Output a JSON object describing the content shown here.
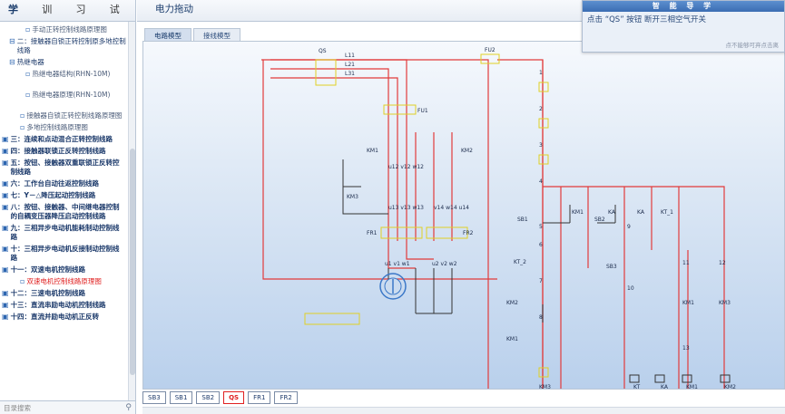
{
  "left_tabs": [
    "教学",
    "实训",
    "练习",
    "考试"
  ],
  "tree": [
    {
      "level": 3,
      "icon": "doc-icon",
      "label": "手动正转控制线路原理图"
    },
    {
      "level": 1,
      "icon": "minus-icon",
      "label": "二：接触器自锁正转控制原多地控制线路"
    },
    {
      "level": 1,
      "icon": "minus-icon",
      "label": "热继电器"
    },
    {
      "level": 3,
      "icon": "doc-icon",
      "label": "热继电器结构(RHN-10M)"
    },
    {
      "level": 3,
      "icon": "doc-icon",
      "label": "热继电器原理(RHN-10M)"
    },
    {
      "level": 2,
      "icon": "doc-icon",
      "label": "接触器自锁正转控制线路原理图"
    },
    {
      "level": 2,
      "icon": "doc-icon",
      "label": "多地控制线路原理图"
    },
    {
      "level": 0,
      "icon": "folder-icon",
      "label": "三：连续和点动混合正转控制线路"
    },
    {
      "level": 0,
      "icon": "folder-icon",
      "label": "四：接触器联锁正反转控制线路"
    },
    {
      "level": 0,
      "icon": "folder-icon",
      "label": "五：按钮、接触器双重联锁正反转控制线路"
    },
    {
      "level": 0,
      "icon": "folder-icon",
      "label": "六：工作台自动往返控制线路"
    },
    {
      "level": 0,
      "icon": "folder-icon",
      "label": "七：Y－△降压起动控制线路"
    },
    {
      "level": 0,
      "icon": "folder-icon",
      "label": "八：按钮、接触器、中间继电器控制的自耦变压器降压启动控制线路"
    },
    {
      "level": 0,
      "icon": "folder-icon",
      "label": "九：三相异步电动机能耗制动控制线路"
    },
    {
      "level": 0,
      "icon": "folder-icon",
      "label": "十：三相异步电动机反接制动控制线路"
    },
    {
      "level": 0,
      "icon": "folder-icon",
      "label": "十一：双速电机控制线路"
    },
    {
      "level": 2,
      "icon": "doc-icon",
      "label": "双速电机控制线路原理图",
      "red": true
    },
    {
      "level": 0,
      "icon": "folder-icon",
      "label": "十二：三速电机控制线路"
    },
    {
      "level": 0,
      "icon": "folder-icon",
      "label": "十三：直流串励电动机控制线路"
    },
    {
      "level": 0,
      "icon": "folder-icon",
      "label": "十四：直流并励电动机正反转"
    }
  ],
  "search": {
    "placeholder": "目录搜索"
  },
  "main_title": "电力拖动",
  "subtabs": [
    "电路模型",
    "接线模型"
  ],
  "buttons": [
    "SB3",
    "SB1",
    "SB2",
    "QS",
    "FR1",
    "FR2"
  ],
  "active_button": "QS",
  "guide": {
    "title": "智 能 导 学",
    "message": "点击 “QS” 按钮  断开三相空气开关",
    "hint": "点不能够可弃点击离"
  },
  "schematic_labels": {
    "QS": "QS",
    "FU2": "FU2",
    "FU1": "FU1",
    "L1": "L11",
    "L2": "L21",
    "L3": "L31",
    "U11": "u11",
    "V11": "v11",
    "W11": "w11",
    "KM1": "KM1",
    "KM2": "KM2",
    "KM3": "KM3",
    "FR1": "FR1",
    "FR2": "FR2",
    "M": "M",
    "U12": "u12",
    "V12": "v12",
    "W12": "w12",
    "U13": "u13",
    "V13": "v13",
    "W13": "w13",
    "V14": "v14",
    "W14": "w14",
    "U14": "u14",
    "U1": "u1",
    "V1": "v1",
    "W1": "w1",
    "U2": "u2",
    "V2": "v2",
    "W2": "w2",
    "SB1": "SB1",
    "SB2": "SB2",
    "SB3": "SB3",
    "KA": "KA",
    "KT": "KT",
    "KT_2": "KT_2",
    "n0": "0",
    "n1": "1",
    "n2": "2",
    "n3": "3",
    "n4": "4",
    "n5": "5",
    "n6": "6",
    "n7": "7",
    "n8": "8",
    "n9": "9",
    "n10": "10",
    "n11": "11",
    "n12": "12",
    "n13": "13"
  },
  "colors": {
    "wire_red": "#e23b3b",
    "wire_dark": "#333333",
    "component": "#e0d024"
  }
}
